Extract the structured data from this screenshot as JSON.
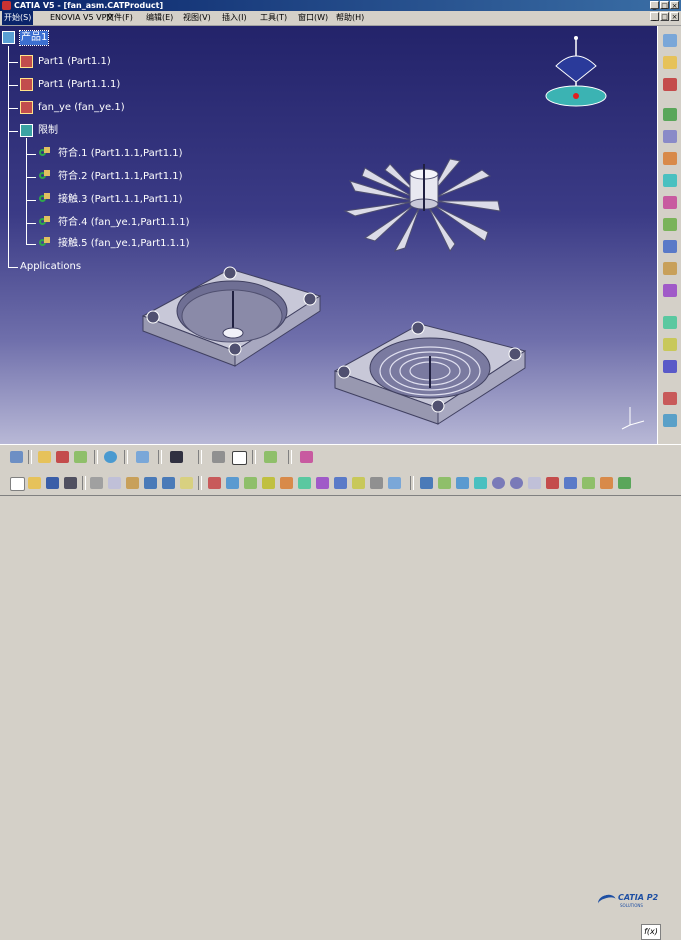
{
  "window": {
    "title": "CATIA V5 - [fan_asm.CATProduct]",
    "controls": [
      "_",
      "□",
      "×"
    ]
  },
  "menubar": {
    "items": [
      {
        "label": "开始(S)",
        "active": true
      },
      {
        "label": "ENOVIA V5 VPM"
      },
      {
        "label": "文件(F)"
      },
      {
        "label": "编辑(E)"
      },
      {
        "label": "视图(V)"
      },
      {
        "label": "插入(I)"
      },
      {
        "label": "工具(T)"
      },
      {
        "label": "窗口(W)"
      },
      {
        "label": "帮助(H)"
      }
    ],
    "doc_controls": [
      "_",
      "□",
      "×"
    ]
  },
  "tree": {
    "root": "产品1",
    "parts": [
      {
        "label": "Part1 (Part1.1)"
      },
      {
        "label": "Part1 (Part1.1.1)"
      },
      {
        "label": "fan_ye (fan_ye.1)"
      }
    ],
    "constraints_group": "限制",
    "constraints": [
      {
        "label": "符合.1 (Part1.1.1,Part1.1)"
      },
      {
        "label": "符合.2 (Part1.1.1,Part1.1)"
      },
      {
        "label": "接触.3 (Part1.1.1,Part1.1)"
      },
      {
        "label": "符合.4 (fan_ye.1,Part1.1.1)"
      },
      {
        "label": "接触.5 (fan_ye.1,Part1.1.1)"
      }
    ],
    "applications": "Applications"
  },
  "viewport": {
    "background_top": "#23236a",
    "background_bottom": "#b8b8d6",
    "models": [
      "fan-blade-rotor",
      "housing-upper",
      "housing-lower-with-grille"
    ],
    "compass_icon": "compass-icon",
    "axis_icon": "axis-triad-icon"
  },
  "logo": {
    "text": "CATIA P2",
    "subtext": "SOLUTIONS"
  },
  "formula_button": {
    "label": "f(x)"
  },
  "colors": {
    "titlebar": "#0a246a",
    "selection": "#3c6fd1",
    "toolbar": "#d4d0c8",
    "brand": "#1e4fa3"
  }
}
